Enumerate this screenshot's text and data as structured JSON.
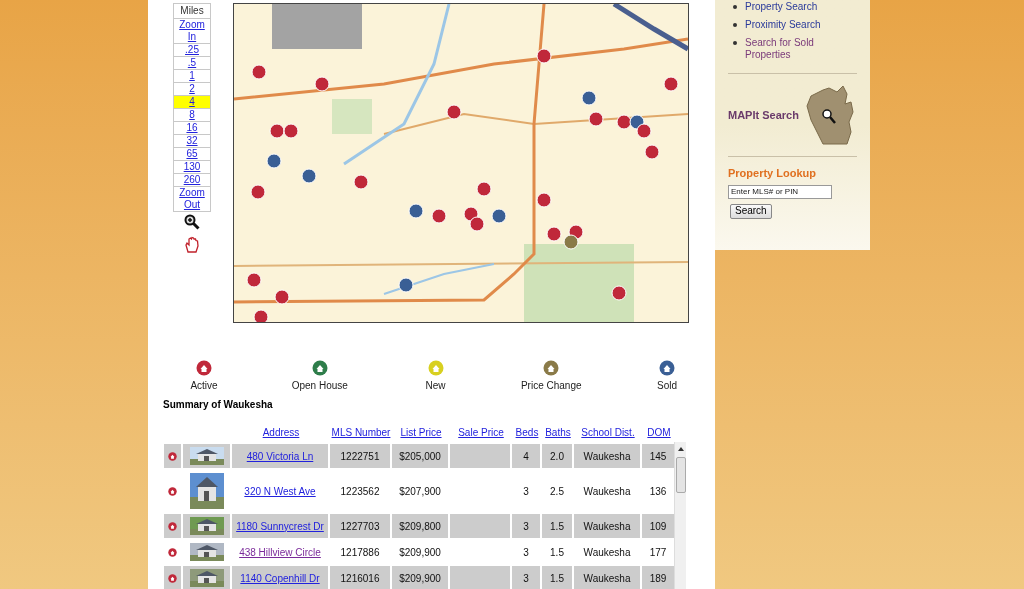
{
  "scale": {
    "header": "Miles",
    "items": [
      {
        "label": "Zoom In",
        "selected": false
      },
      {
        "label": ".25",
        "selected": false
      },
      {
        "label": ".5",
        "selected": false
      },
      {
        "label": "1",
        "selected": false
      },
      {
        "label": "2",
        "selected": false
      },
      {
        "label": "4",
        "selected": true
      },
      {
        "label": "8",
        "selected": false
      },
      {
        "label": "16",
        "selected": false
      },
      {
        "label": "32",
        "selected": false
      },
      {
        "label": "65",
        "selected": false
      },
      {
        "label": "130",
        "selected": false
      },
      {
        "label": "260",
        "selected": false
      },
      {
        "label": "Zoom Out",
        "selected": false
      }
    ]
  },
  "legend": [
    {
      "label": "Active",
      "color": "#c0283a"
    },
    {
      "label": "Open House",
      "color": "#2e7d4a"
    },
    {
      "label": "New",
      "color": "#d8d020"
    },
    {
      "label": "Price Change",
      "color": "#8a7a48"
    },
    {
      "label": "Sold",
      "color": "#3a5f95"
    }
  ],
  "summary_title": "Summary of Waukesha",
  "table": {
    "columns": [
      "Address",
      "MLS Number",
      "List Price",
      "Sale Price",
      "Beds",
      "Baths",
      "School Dist.",
      "DOM"
    ],
    "rows": [
      {
        "color": "#c0283a",
        "address": "480 Victoria Ln",
        "visited": false,
        "mls": "1222751",
        "list_price": "$205,000",
        "beds": "4",
        "baths": "2.0",
        "school": "Waukesha",
        "dom": "145"
      },
      {
        "color": "#c0283a",
        "address": "320 N West Ave",
        "visited": false,
        "mls": "1223562",
        "list_price": "$207,900",
        "beds": "3",
        "baths": "2.5",
        "school": "Waukesha",
        "dom": "136"
      },
      {
        "color": "#c0283a",
        "address": "1180 Sunnycrest Dr",
        "visited": false,
        "mls": "1227703",
        "list_price": "$209,800",
        "beds": "3",
        "baths": "1.5",
        "school": "Waukesha",
        "dom": "109"
      },
      {
        "color": "#c0283a",
        "address": "438 Hillview Circle",
        "visited": true,
        "mls": "1217886",
        "list_price": "$209,900",
        "beds": "3",
        "baths": "1.5",
        "school": "Waukesha",
        "dom": "177"
      },
      {
        "color": "#c0283a",
        "address": "1140 Copenhill Dr",
        "visited": false,
        "mls": "1216016",
        "list_price": "$209,900",
        "beds": "3",
        "baths": "1.5",
        "school": "Waukesha",
        "dom": "189"
      }
    ]
  },
  "sidebar": {
    "links": [
      {
        "label": "Property Search",
        "visited": false
      },
      {
        "label": "Proximity Search",
        "visited": false
      },
      {
        "label": "Search for Sold Properties",
        "visited": true
      }
    ],
    "mapit_title": "MAPIt Search",
    "lookup_title": "Property Lookup",
    "lookup_placeholder": "Enter MLS# or PIN",
    "lookup_button": "Search"
  }
}
